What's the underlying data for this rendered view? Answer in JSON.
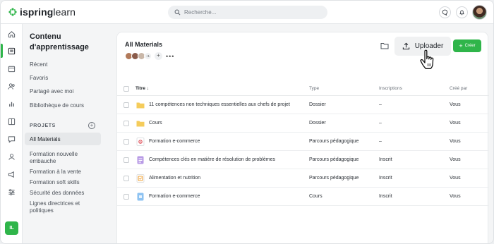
{
  "brand": {
    "name_bold": "ispring",
    "name_rest": "learn",
    "accent": "#2fb54a"
  },
  "search": {
    "placeholder": "Recherche..."
  },
  "rail": {
    "user_initials": "IL",
    "icons": [
      "home-icon",
      "library-icon",
      "calendar-icon",
      "users-icon",
      "reports-icon",
      "tasks-icon",
      "messages-icon",
      "meetings-icon",
      "megaphone-icon",
      "settings-icon"
    ]
  },
  "nav": {
    "title": "Contenu d'apprentissage",
    "items": [
      "Récent",
      "Favoris",
      "Partagé avec moi",
      "Bibliothèque de cours"
    ],
    "section_label": "PROJETS",
    "projects": [
      "All Materials",
      "Formation nouvelle embauche",
      "Formation à la vente",
      "Formation soft skills",
      "Sécurité des données",
      "Lignes directrices et politiques"
    ]
  },
  "main": {
    "title": "All Materials",
    "avatars_extra": "+1",
    "more": "•••",
    "upload_label": "Uploader",
    "create_label": "Créer",
    "columns": [
      "Titre",
      "Type",
      "Inscriptions",
      "Créé par"
    ],
    "rows": [
      {
        "title": "11 compétences non techniques essentielles aux chefs de projet",
        "type": "Dossier",
        "enrollments": "–",
        "created_by": "Vous",
        "icon": "folder-icon"
      },
      {
        "title": "Cours",
        "type": "Dossier",
        "enrollments": "–",
        "created_by": "Vous",
        "icon": "folder-icon"
      },
      {
        "title": "Formation e-commerce",
        "type": "Parcours pédagogique",
        "enrollments": "–",
        "created_by": "Vous",
        "icon": "learning-path-icon"
      },
      {
        "title": "Compétences clés en matière de résolution de problèmes",
        "type": "Parcours pédagogique",
        "enrollments": "Inscrit",
        "created_by": "Vous",
        "icon": "learning-path-icon"
      },
      {
        "title": "Alimentation et nutrition",
        "type": "Parcours pédagogique",
        "enrollments": "Inscrit",
        "created_by": "Vous",
        "icon": "learning-path-icon"
      },
      {
        "title": "Formation e-commerce",
        "type": "Cours",
        "enrollments": "Inscrit",
        "created_by": "Vous",
        "icon": "course-icon"
      }
    ]
  }
}
